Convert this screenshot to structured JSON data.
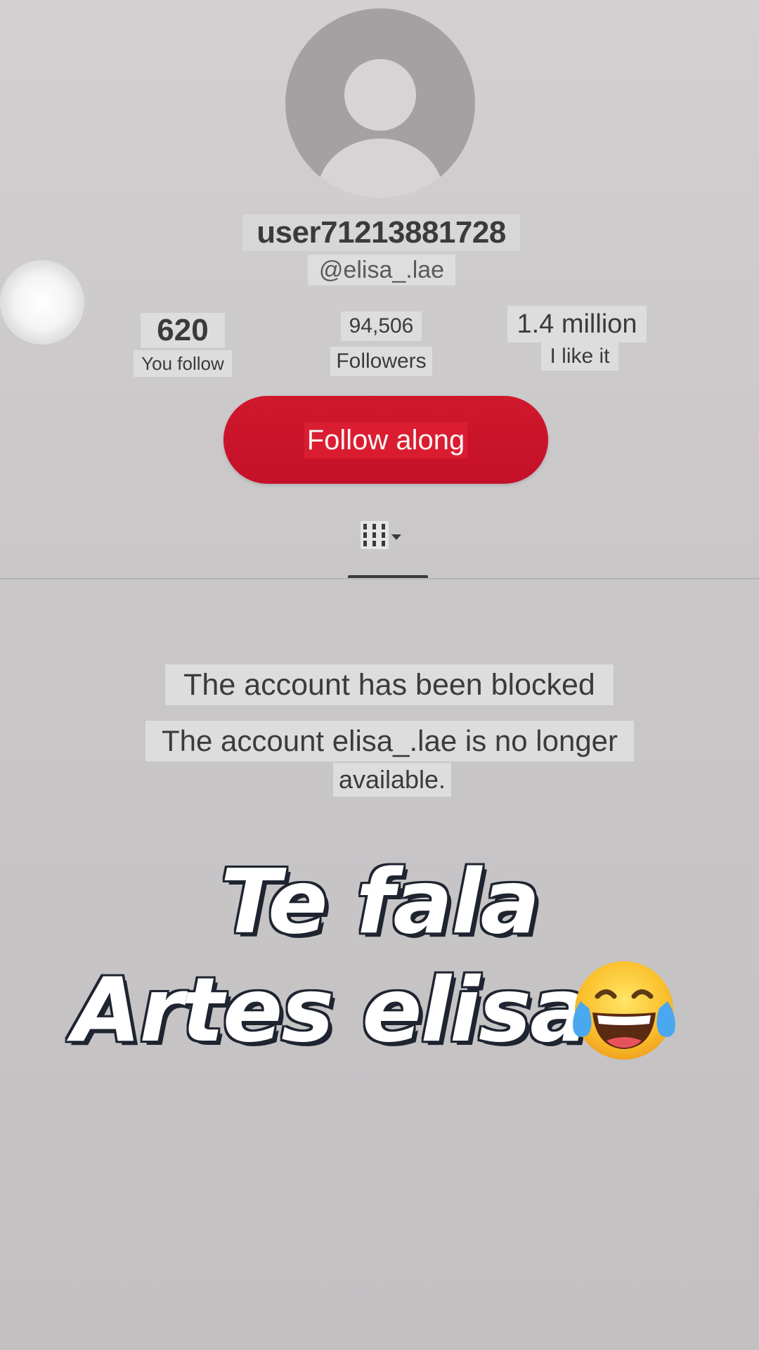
{
  "profile": {
    "username": "user71213881728",
    "handle": "@elisa_.lae"
  },
  "stats": [
    {
      "value": "620",
      "label": "You follow"
    },
    {
      "value": "94,506",
      "label": "Followers"
    },
    {
      "value": "1.4 million",
      "label": "I like it"
    }
  ],
  "follow_button": {
    "label": "Follow along",
    "color": "#c8142b"
  },
  "tab": {
    "icon": "grid-icon"
  },
  "notice": {
    "title": "The account has been blocked",
    "message_line1": "The account elisa_.lae is no longer",
    "message_line2": "available."
  },
  "caption": {
    "line1": "Te fala",
    "line2": "Artes elisa",
    "emoji": "tears-of-joy-emoji"
  }
}
